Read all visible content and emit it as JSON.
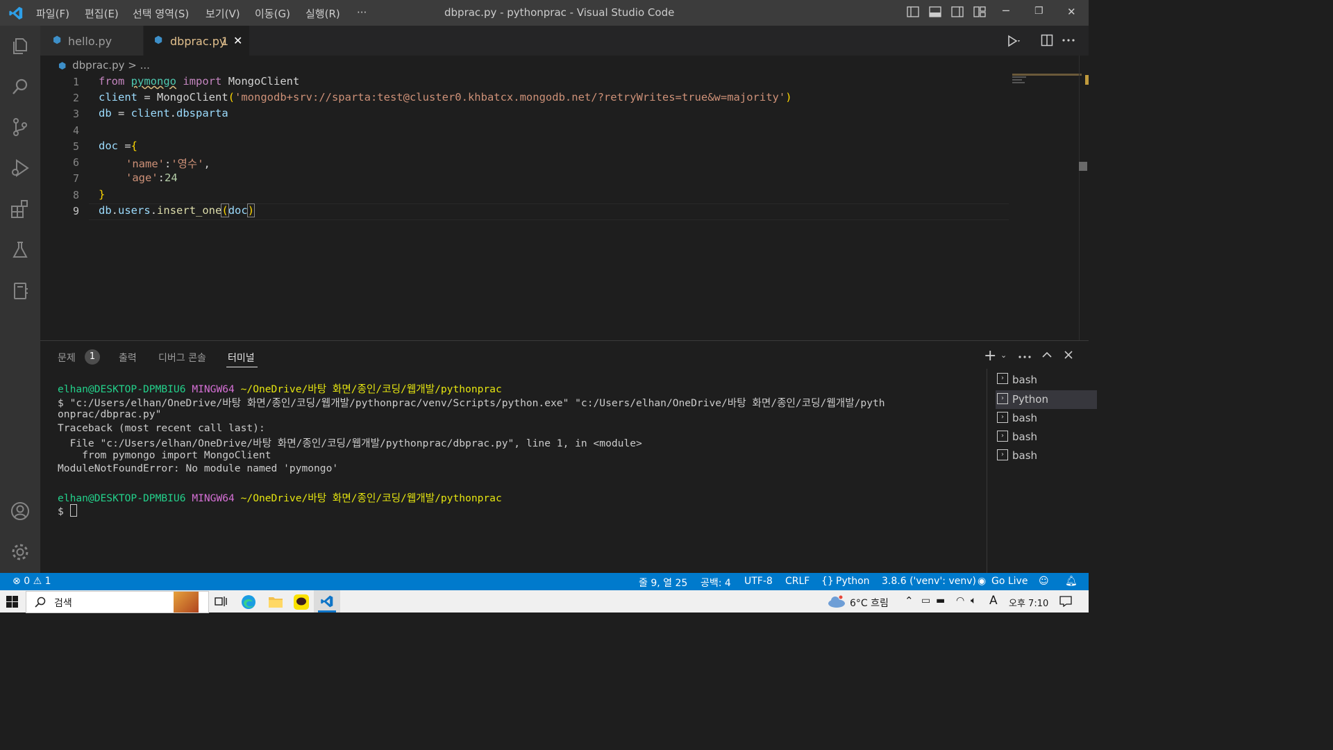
{
  "window": {
    "title": "dbprac.py - pythonprac - Visual Studio Code",
    "menu": [
      "파일(F)",
      "편집(E)",
      "선택 영역(S)",
      "보기(V)",
      "이동(G)",
      "실행(R)",
      "···"
    ],
    "controls": {
      "minimize": "─",
      "restore": "❐",
      "close": "✕"
    }
  },
  "tabs": [
    {
      "label": "hello.py",
      "active": false
    },
    {
      "label": "dbprac.py",
      "active": true,
      "problems": "1",
      "close": "✕"
    }
  ],
  "breadcrumb": {
    "file": "dbprac.py",
    "sep": ">",
    "rest": "..."
  },
  "editor": {
    "line_numbers": [
      "1",
      "2",
      "3",
      "4",
      "5",
      "6",
      "7",
      "8",
      "9"
    ],
    "current_line": "9",
    "tokens": {
      "l1": [
        "from",
        " ",
        "pymongo",
        " ",
        "import",
        " ",
        "MongoClient"
      ],
      "l2": [
        "client",
        " = ",
        "MongoClient",
        "(",
        "'mongodb+srv://sparta:test@cluster0.khbatcx.mongodb.net/?retryWrites=true&w=majority'",
        ")"
      ],
      "l3": [
        "db",
        " = ",
        "client",
        ".",
        "dbsparta"
      ],
      "l5": [
        "doc",
        " =",
        "{"
      ],
      "l6": [
        "'name'",
        ":",
        "'영수'",
        ","
      ],
      "l7": [
        "'age'",
        ":",
        "24"
      ],
      "l8": [
        "}"
      ],
      "l9": [
        "db",
        ".",
        "users",
        ".",
        "insert_one",
        "(",
        "doc",
        ")"
      ]
    }
  },
  "panel": {
    "tabs": [
      "문제",
      "출력",
      "디버그 콘솔",
      "터미널"
    ],
    "problems_count": "1",
    "active_tab": "터미널",
    "terminal": {
      "prompt_user": "elhan@DESKTOP-DPMBIU6",
      "prompt_env": "MINGW64",
      "prompt_path": "~/OneDrive/바탕 화면/종인/코딩/웹개발/pythonprac",
      "cmd_line1": "$ \"c:/Users/elhan/OneDrive/바탕 화면/종인/코딩/웹개발/pythonprac/venv/Scripts/python.exe\" \"c:/Users/elhan/OneDrive/바탕 화면/종인/코딩/웹개발/pyth",
      "cmd_line2": "onprac/dbprac.py\"",
      "tb1": "Traceback (most recent call last):",
      "tb2": "  File \"c:/Users/elhan/OneDrive/바탕 화면/종인/코딩/웹개발/pythonprac/dbprac.py\", line 1, in <module>",
      "tb3": "    from pymongo import MongoClient",
      "tb4": "ModuleNotFoundError: No module named 'pymongo'",
      "prompt2_user": "elhan@DESKTOP-DPMBIU6",
      "prompt2_env": "MINGW64",
      "prompt2_path": "~/OneDrive/바탕 화면/종인/코딩/웹개발/pythonprac",
      "dollar": "$"
    },
    "terminal_list": [
      "bash",
      "Python",
      "bash",
      "bash",
      "bash"
    ],
    "selected_terminal": "Python"
  },
  "statusbar": {
    "errors": "0",
    "warnings": "1",
    "position": "줄 9, 열 25",
    "spaces": "공백: 4",
    "encoding": "UTF-8",
    "eol": "CRLF",
    "language": "Python",
    "interpreter": "3.8.6 ('venv': venv)",
    "golive": "Go Live"
  },
  "taskbar": {
    "search": "검색",
    "weather": "6°C 흐림",
    "ime": "A",
    "clock": "오후 7:10"
  },
  "colors": {
    "accent": "#007acc",
    "modified_tab": "#e2c08d",
    "terminal_green": "#23d18b",
    "terminal_magenta": "#d670d6",
    "terminal_yellow": "#e5e510"
  },
  "icons": [
    "vscode-logo-icon",
    "explorer-icon",
    "search-icon",
    "source-control-icon",
    "run-debug-icon",
    "extensions-icon",
    "testing-icon",
    "remote-explorer-icon",
    "accounts-icon",
    "manage-gear-icon",
    "python-file-icon",
    "run-file-icon",
    "split-editor-icon",
    "new-terminal-icon",
    "windows-start-icon",
    "task-view-icon",
    "edge-icon",
    "file-explorer-icon",
    "kakaotalk-icon",
    "vscode-taskbar-icon",
    "weather-cloud-icon",
    "notification-icon"
  ]
}
